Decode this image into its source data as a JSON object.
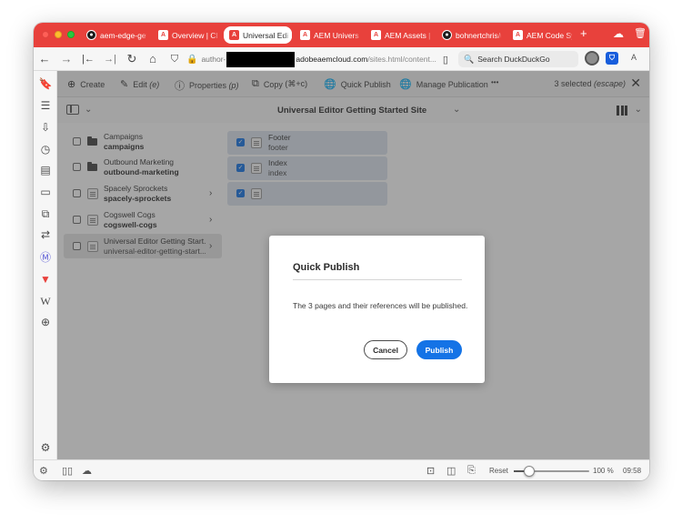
{
  "browser": {
    "tabs": [
      {
        "label": "aem-edge-gett",
        "icon": "github-icon",
        "active": false
      },
      {
        "label": "Overview | Clou",
        "icon": "adobe-icon",
        "active": false
      },
      {
        "label": "Universal Editor",
        "icon": "adobe-icon",
        "active": true
      },
      {
        "label": "AEM Universal E",
        "icon": "adobe-icon",
        "active": false
      },
      {
        "label": "AEM Assets | F",
        "icon": "adobe-icon",
        "active": false
      },
      {
        "label": "bohnertchris/u",
        "icon": "github-icon",
        "active": false
      },
      {
        "label": "AEM Code Sync",
        "icon": "adobe-icon",
        "active": false
      }
    ],
    "new_tab": "+",
    "url": {
      "prefix": "author-",
      "host": "adobeaemcloud.com",
      "path": "/sites.html/content..."
    },
    "search_placeholder": "Search DuckDuckGo",
    "reader_label": "A"
  },
  "toolbar": {
    "create": "Create",
    "edit": "Edit",
    "edit_shortcut": "(e)",
    "properties": "Properties",
    "properties_shortcut": "(p)",
    "copy": "Copy",
    "copy_shortcut": "(⌘+c)",
    "quick_publish": "Quick Publish",
    "manage_publication": "Manage Publication",
    "more": "•••",
    "selected_count": "3 selected",
    "selected_hint": "(escape)"
  },
  "site": {
    "title": "Universal Editor Getting Started Site"
  },
  "column1": [
    {
      "title": "Campaigns",
      "name": "campaigns",
      "type": "folder",
      "has_children": false,
      "selected": false
    },
    {
      "title": "Outbound Marketing",
      "name": "outbound-marketing",
      "type": "folder",
      "has_children": false,
      "selected": false
    },
    {
      "title": "Spacely Sprockets",
      "name": "spacely-sprockets",
      "type": "page",
      "has_children": true,
      "selected": false
    },
    {
      "title": "Cogswell Cogs",
      "name": "cogswell-cogs",
      "type": "page",
      "has_children": true,
      "selected": false
    },
    {
      "title": "Universal Editor Getting Start...",
      "name": "universal-editor-getting-start...",
      "type": "page",
      "has_children": true,
      "selected": true
    }
  ],
  "column2": [
    {
      "title": "Footer",
      "name": "footer",
      "checked": true
    },
    {
      "title": "Index",
      "name": "index",
      "checked": true
    },
    {
      "title": "",
      "name": "",
      "checked": true
    }
  ],
  "dialog": {
    "title": "Quick Publish",
    "message": "The 3 pages and their references will be published.",
    "cancel": "Cancel",
    "publish": "Publish"
  },
  "statusbar": {
    "reset": "Reset",
    "zoom": "100 %",
    "zoom_level": 0.2,
    "time": "09:58"
  },
  "colors": {
    "tabbar": "#e8413c",
    "accent": "#1473e6"
  }
}
